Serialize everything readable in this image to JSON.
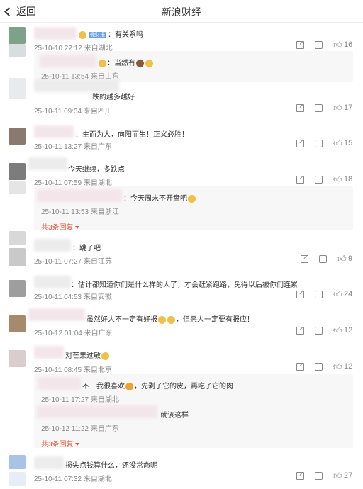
{
  "header": {
    "back_label": "返回",
    "title": "新浪财经"
  },
  "comments": [
    {
      "text": "：有关系吗",
      "badge": "微财报",
      "meta": "25-10-10 22:12  来自湖北",
      "likes": "16"
    },
    {
      "text": "：当然有",
      "meta": "25-10-11 13:54  来自山东"
    },
    {
      "text": "跌的越多越好 ·",
      "meta": "25-10-11 09:34  来自四川",
      "likes": "17"
    },
    {
      "text": "：生而为人，向阳而生！正义必胜！",
      "meta": "25-10-11 13:27  来自广东",
      "likes": "15"
    },
    {
      "text": "今天继续，多跌点",
      "meta": "25-10-11 07:59  来自湖北",
      "likes": "18"
    },
    {
      "text": "：今天周末不开盘吧",
      "meta": "25-10-11 13:53  来自浙江",
      "more": "共3条回复"
    },
    {
      "text": "：跳了吧",
      "meta": "25-10-11 07:27  来自江苏",
      "likes": "9"
    },
    {
      "text": "：估计都知道你们是什么样的人了，才会赶紧跑路，免得以后被你们连累",
      "meta": "25-10-11 04:53  来自安徽",
      "likes": "24"
    },
    {
      "text": "虽然好人不一定有好报",
      "text2": "，但恶人一定要有报应！",
      "meta": "25-10-12 01:04  来自广东",
      "likes": "12"
    },
    {
      "text": "对芒果过敏",
      "meta": "25-10-11 08:45  来自北京",
      "likes": "12"
    },
    {
      "text": "不！我很喜欢",
      "text2": "，先剥了它的皮，再吃了它的肉！",
      "meta": "25-10-11 17:27  来自湖北"
    },
    {
      "text": "就该这样",
      "meta": "25-10-12 11:22  来自广东",
      "more": "共3条回复"
    },
    {
      "text": "损失点钱算什么，还没常命呢",
      "meta": "25-10-11 07:32  来自湖北",
      "likes": "27"
    }
  ],
  "colors": {
    "link": "#e05a3a",
    "meta": "#888888"
  }
}
